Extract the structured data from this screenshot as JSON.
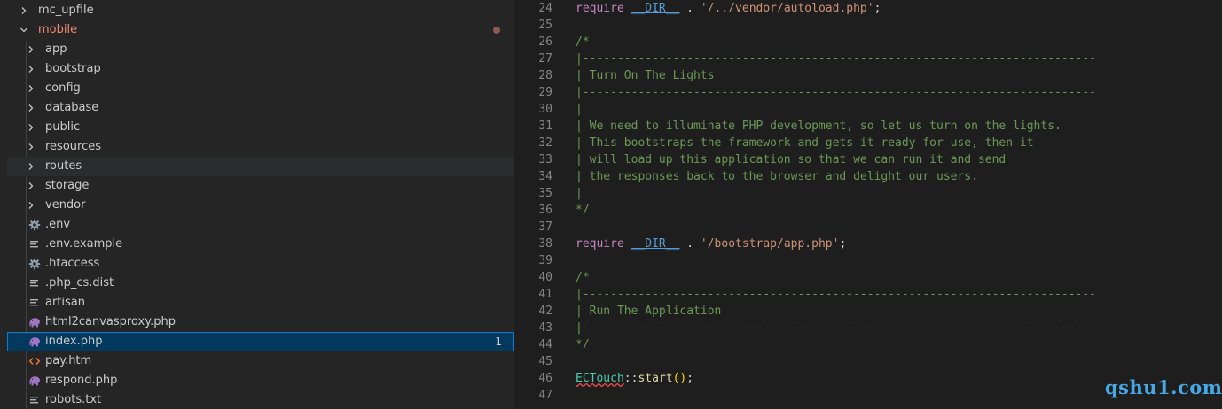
{
  "explorer": {
    "items": [
      {
        "label": "mc_upfile",
        "kind": "folder",
        "state": "collapsed",
        "depth": 0
      },
      {
        "label": "mobile",
        "kind": "folder",
        "state": "expanded",
        "depth": 0,
        "color": "#f48771",
        "modified": true
      },
      {
        "label": "app",
        "kind": "folder",
        "state": "collapsed",
        "depth": 1
      },
      {
        "label": "bootstrap",
        "kind": "folder",
        "state": "collapsed",
        "depth": 1
      },
      {
        "label": "config",
        "kind": "folder",
        "state": "collapsed",
        "depth": 1
      },
      {
        "label": "database",
        "kind": "folder",
        "state": "collapsed",
        "depth": 1
      },
      {
        "label": "public",
        "kind": "folder",
        "state": "collapsed",
        "depth": 1
      },
      {
        "label": "resources",
        "kind": "folder",
        "state": "collapsed",
        "depth": 1
      },
      {
        "label": "routes",
        "kind": "folder",
        "state": "collapsed",
        "depth": 1,
        "hover": true
      },
      {
        "label": "storage",
        "kind": "folder",
        "state": "collapsed",
        "depth": 1
      },
      {
        "label": "vendor",
        "kind": "folder",
        "state": "collapsed",
        "depth": 1
      },
      {
        "label": ".env",
        "kind": "file",
        "icon": "gear-icon",
        "depth": 1
      },
      {
        "label": ".env.example",
        "kind": "file",
        "icon": "lines-icon",
        "depth": 1
      },
      {
        "label": ".htaccess",
        "kind": "file",
        "icon": "gear-icon",
        "depth": 1
      },
      {
        "label": ".php_cs.dist",
        "kind": "file",
        "icon": "lines-icon",
        "depth": 1
      },
      {
        "label": "artisan",
        "kind": "file",
        "icon": "lines-icon",
        "depth": 1
      },
      {
        "label": "html2canvasproxy.php",
        "kind": "file",
        "icon": "php-elephant-icon",
        "depth": 1
      },
      {
        "label": "index.php",
        "kind": "file",
        "icon": "php-elephant-icon",
        "depth": 1,
        "selected": true,
        "badge": "1"
      },
      {
        "label": "pay.htm",
        "kind": "file",
        "icon": "html-code-icon",
        "depth": 1
      },
      {
        "label": "respond.php",
        "kind": "file",
        "icon": "php-elephant-icon",
        "depth": 1
      },
      {
        "label": "robots.txt",
        "kind": "file",
        "icon": "lines-icon",
        "depth": 1
      }
    ]
  },
  "editor": {
    "lines": [
      {
        "n": "24",
        "tokens": [
          [
            "kw",
            "require"
          ],
          [
            "op",
            " "
          ],
          [
            "const",
            "__DIR__"
          ],
          [
            "op",
            " . "
          ],
          [
            "str",
            "'/../vendor/autoload.php'"
          ],
          [
            "op",
            ";"
          ]
        ]
      },
      {
        "n": "25",
        "tokens": []
      },
      {
        "n": "26",
        "tokens": [
          [
            "cm",
            "/*"
          ]
        ]
      },
      {
        "n": "27",
        "tokens": [
          [
            "cm",
            "|--------------------------------------------------------------------------"
          ]
        ]
      },
      {
        "n": "28",
        "tokens": [
          [
            "cm",
            "| Turn On The Lights"
          ]
        ]
      },
      {
        "n": "29",
        "tokens": [
          [
            "cm",
            "|--------------------------------------------------------------------------"
          ]
        ]
      },
      {
        "n": "30",
        "tokens": [
          [
            "cm",
            "|"
          ]
        ]
      },
      {
        "n": "31",
        "tokens": [
          [
            "cm",
            "| We need to illuminate PHP development, so let us turn on the lights."
          ]
        ]
      },
      {
        "n": "32",
        "tokens": [
          [
            "cm",
            "| This bootstraps the framework and gets it ready for use, then it"
          ]
        ]
      },
      {
        "n": "33",
        "tokens": [
          [
            "cm",
            "| will load up this application so that we can run it and send"
          ]
        ]
      },
      {
        "n": "34",
        "tokens": [
          [
            "cm",
            "| the responses back to the browser and delight our users."
          ]
        ]
      },
      {
        "n": "35",
        "tokens": [
          [
            "cm",
            "|"
          ]
        ]
      },
      {
        "n": "36",
        "tokens": [
          [
            "cm",
            "*/"
          ]
        ]
      },
      {
        "n": "37",
        "tokens": []
      },
      {
        "n": "38",
        "tokens": [
          [
            "kw",
            "require"
          ],
          [
            "op",
            " "
          ],
          [
            "const",
            "__DIR__"
          ],
          [
            "op",
            " . "
          ],
          [
            "str",
            "'/bootstrap/app.php'"
          ],
          [
            "op",
            ";"
          ]
        ]
      },
      {
        "n": "39",
        "tokens": []
      },
      {
        "n": "40",
        "tokens": [
          [
            "cm",
            "/*"
          ]
        ]
      },
      {
        "n": "41",
        "tokens": [
          [
            "cm",
            "|--------------------------------------------------------------------------"
          ]
        ]
      },
      {
        "n": "42",
        "tokens": [
          [
            "cm",
            "| Run The Application"
          ]
        ]
      },
      {
        "n": "43",
        "tokens": [
          [
            "cm",
            "|--------------------------------------------------------------------------"
          ]
        ]
      },
      {
        "n": "44",
        "tokens": [
          [
            "cm",
            "*/"
          ]
        ]
      },
      {
        "n": "45",
        "tokens": []
      },
      {
        "n": "46",
        "tokens": [
          [
            "cls",
            "ECTouch"
          ],
          [
            "op",
            "::"
          ],
          [
            "fn",
            "start"
          ],
          [
            "br",
            "()"
          ],
          [
            "op",
            ";"
          ]
        ]
      },
      {
        "n": "47",
        "tokens": []
      }
    ]
  },
  "watermark": "qshu1.com",
  "colors": {
    "sidebar_bg": "#252526",
    "editor_bg": "#1e1e1e",
    "selection_bg": "#04395e",
    "selection_border": "#007fd4",
    "modified_folder": "#f48771",
    "php_icon": "#a074c4",
    "html_icon": "#e37933",
    "watermark": "#46a8e6"
  }
}
